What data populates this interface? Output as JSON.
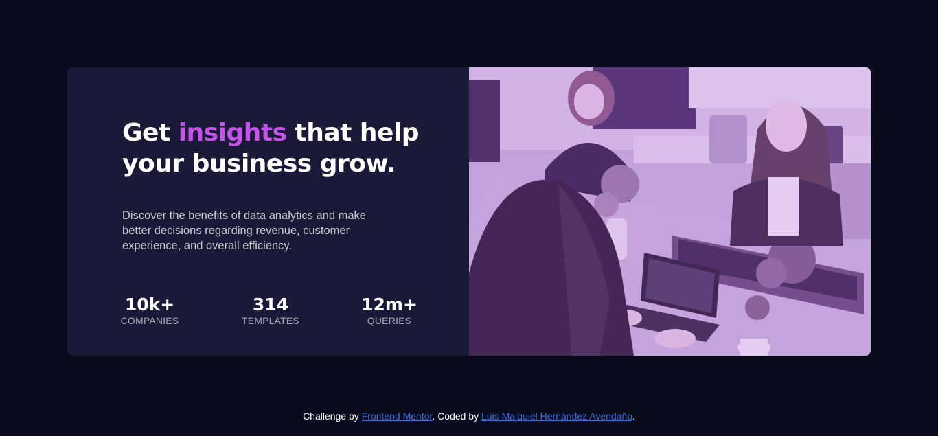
{
  "hero": {
    "headline_before": "Get ",
    "headline_accent": "insights",
    "headline_after": " that help your business grow.",
    "description": "Discover the benefits of data analytics and make better decisions regarding revenue, customer experience, and overall efficiency."
  },
  "stats": [
    {
      "value": "10k+",
      "label": "COMPANIES"
    },
    {
      "value": "314",
      "label": "TEMPLATES"
    },
    {
      "value": "12m+",
      "label": "QUERIES"
    }
  ],
  "attribution": {
    "prefix": "Challenge by ",
    "link1": "Frontend Mentor",
    "middle": ". Coded by ",
    "link2": "Luis Malquiel Hernández Avendaño",
    "suffix": "."
  },
  "colors": {
    "page_background": "#090b1d",
    "card_background": "#1b1938",
    "accent": "#c353e9",
    "image_overlay": "#aa5cdb",
    "link": "#3e6ed4"
  }
}
